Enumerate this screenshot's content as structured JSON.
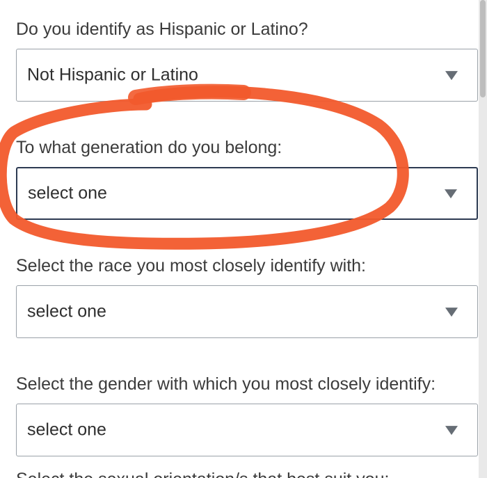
{
  "fields": [
    {
      "label": "Do you identify as Hispanic or Latino?",
      "value": "Not Hispanic or Latino",
      "icon": "chevron-down-icon"
    },
    {
      "label": "To what generation do you belong:",
      "value": "select one",
      "icon": "chevron-down-icon",
      "focused": true
    },
    {
      "label": "Select the race you most closely identify with:",
      "value": "select one",
      "icon": "chevron-down-icon"
    },
    {
      "label": "Select the gender with which you most closely identify:",
      "value": "select one",
      "icon": "chevron-down-icon"
    },
    {
      "label": "Select the sexual orientation/s that best suit you:"
    }
  ],
  "annotation": {
    "type": "hand-drawn circle",
    "color": "#f25a2c"
  },
  "colors": {
    "focus_border": "#2c3a52",
    "border": "#9aa1a8",
    "text": "#3b3b3b"
  }
}
